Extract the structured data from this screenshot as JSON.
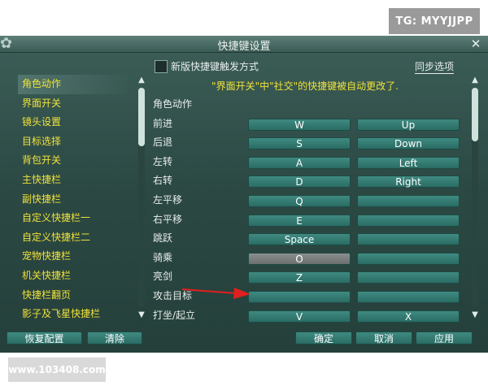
{
  "watermark_top": "TG: MYYJJPP",
  "watermark_bottom": "www.103408.com",
  "window": {
    "title": "快捷键设置",
    "close_icon": "close-icon"
  },
  "sidebar": {
    "items": [
      {
        "label": "角色动作",
        "active": true
      },
      {
        "label": "界面开关"
      },
      {
        "label": "镜头设置"
      },
      {
        "label": "目标选择"
      },
      {
        "label": "背包开关"
      },
      {
        "label": "主快捷栏"
      },
      {
        "label": "副快捷栏"
      },
      {
        "label": "自定义快捷栏一"
      },
      {
        "label": "自定义快捷栏二"
      },
      {
        "label": "宠物快捷栏"
      },
      {
        "label": "机关快捷栏"
      },
      {
        "label": "快捷栏翻页"
      },
      {
        "label": "影子及飞星快捷栏"
      }
    ]
  },
  "options": {
    "checkbox_label": "新版快捷键触发方式",
    "checkbox_checked": false,
    "sync_label": "同步选项"
  },
  "notice": "\"界面开关\"中\"社交\"的快捷键被自动更改了.",
  "section_title": "角色动作",
  "bindings": [
    {
      "label": "前进",
      "key1": "W",
      "key2": "Up"
    },
    {
      "label": "后退",
      "key1": "S",
      "key2": "Down"
    },
    {
      "label": "左转",
      "key1": "A",
      "key2": "Left"
    },
    {
      "label": "右转",
      "key1": "D",
      "key2": "Right"
    },
    {
      "label": "左平移",
      "key1": "Q",
      "key2": ""
    },
    {
      "label": "右平移",
      "key1": "E",
      "key2": ""
    },
    {
      "label": "跳跃",
      "key1": "Space",
      "key2": ""
    },
    {
      "label": "骑乘",
      "key1": "O",
      "key2": "",
      "selected": true
    },
    {
      "label": "亮剑",
      "key1": "Z",
      "key2": ""
    },
    {
      "label": "攻击目标",
      "key1": "",
      "key2": ""
    },
    {
      "label": "打坐/起立",
      "key1": "V",
      "key2": "X"
    }
  ],
  "buttons": {
    "reset": "恢复配置",
    "clear": "清除",
    "ok": "确定",
    "cancel": "取消",
    "apply": "应用"
  },
  "colors": {
    "accent_yellow": "#f0e23a",
    "button_teal": "#3f8a81",
    "annotation_red": "#e02020"
  }
}
